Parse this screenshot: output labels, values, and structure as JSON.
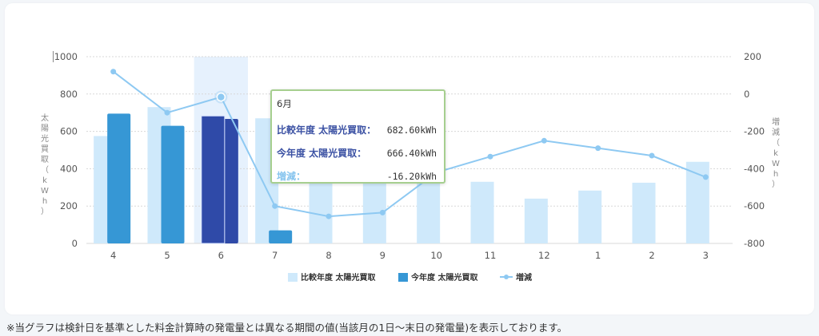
{
  "chart_data": {
    "type": "bar",
    "categories": [
      "4",
      "5",
      "6",
      "7",
      "8",
      "9",
      "10",
      "11",
      "12",
      "1",
      "2",
      "3"
    ],
    "series": [
      {
        "name": "比較年度 太陽光買取",
        "type": "bar",
        "axis": "left",
        "values": [
          575,
          730,
          682.6,
          670,
          400,
          350,
          375,
          330,
          240,
          283,
          325,
          437
        ]
      },
      {
        "name": "今年度 太陽光買取",
        "type": "bar",
        "axis": "left",
        "values": [
          695,
          630,
          666.4,
          70,
          null,
          null,
          null,
          null,
          null,
          null,
          null,
          null
        ]
      },
      {
        "name": "増減",
        "type": "line",
        "axis": "right",
        "values": [
          120,
          -100,
          -16.2,
          -600,
          -655,
          -635,
          -420,
          -335,
          -250,
          -290,
          -330,
          -445
        ]
      }
    ],
    "y_left": {
      "label": "太陽光買取（kWh）",
      "ticks": [
        "0",
        "200",
        "400",
        "600",
        "800",
        "1000"
      ],
      "ylim": [
        0,
        1000
      ]
    },
    "y_right": {
      "label": "増減（kWh）",
      "ticks": [
        "-800",
        "-600",
        "-400",
        "-200",
        "0",
        "200"
      ],
      "ylim": [
        -800,
        200
      ]
    },
    "highlight_category": "6",
    "grid": true,
    "legend_position": "bottom-center",
    "colors": {
      "compare": "#cfe9fb",
      "current": "#3697d5",
      "current_highlight": "#2f4aa8",
      "line": "#8ec9f2",
      "highlight_band": "#e6f1fd",
      "grid": "#d8d8d8"
    }
  },
  "tooltip": {
    "title": "6月",
    "rows": [
      {
        "label": "比較年度 太陽光買取：",
        "value": "682.60kWh",
        "color": "#3b51a3"
      },
      {
        "label": "今年度 太陽光買取：",
        "value": "666.40kWh",
        "color": "#3b51a3"
      },
      {
        "label": "増減：",
        "value": "-16.20kWh",
        "color": "#86c4ee"
      }
    ]
  },
  "note": "※当グラフは検針日を基準とした料金計算時の発電量とは異なる期間の値(当該月の1日～末日の発電量)を表示しております。"
}
